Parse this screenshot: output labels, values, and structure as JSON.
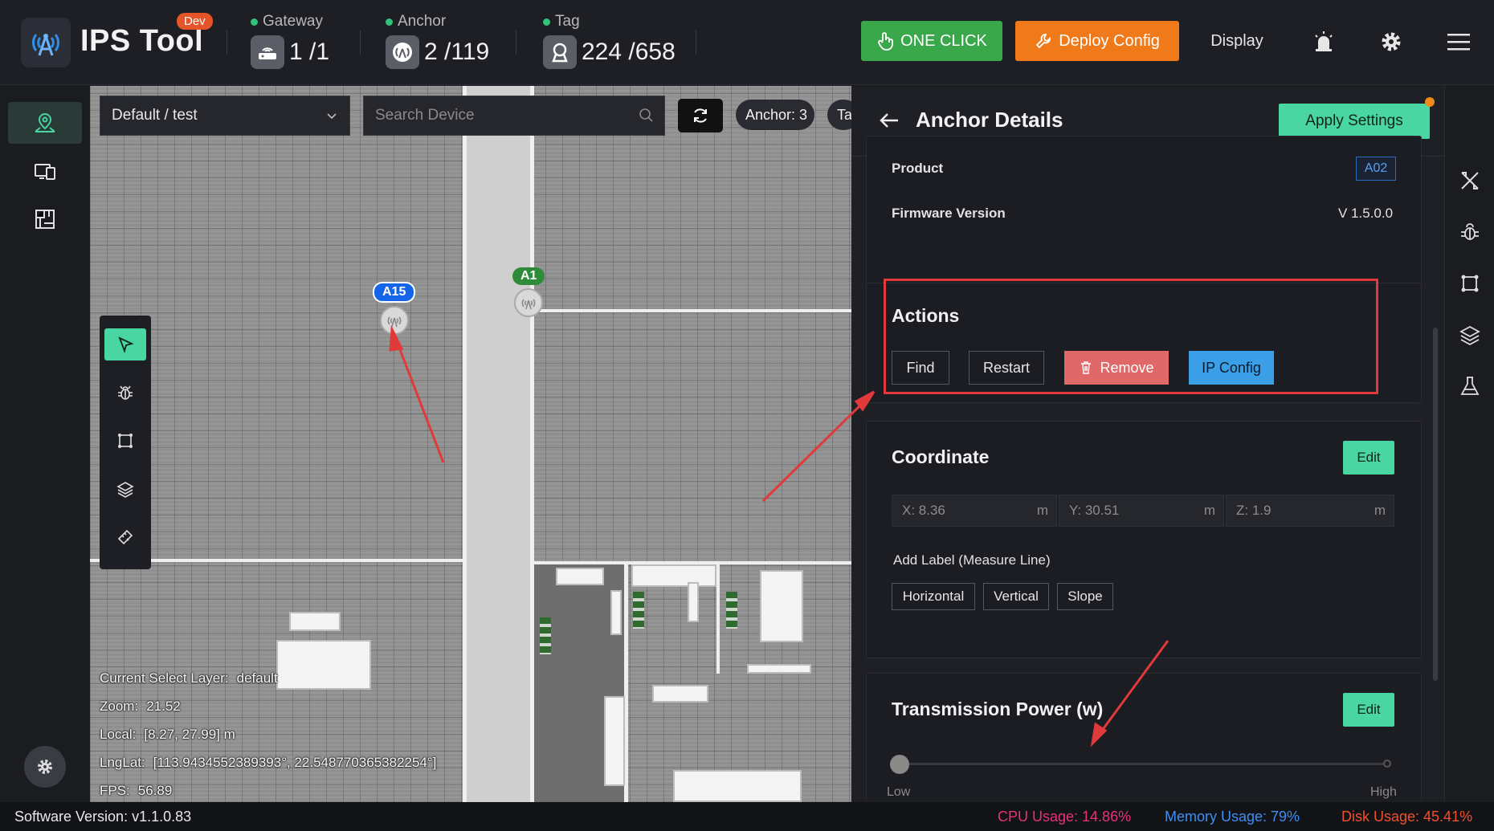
{
  "app": {
    "title": "IPS Tool",
    "badge": "Dev"
  },
  "stats": {
    "gateway": {
      "label": "Gateway",
      "value": "1 /1"
    },
    "anchor": {
      "label": "Anchor",
      "value": "2 /119"
    },
    "tag": {
      "label": "Tag",
      "value": "224 /658"
    }
  },
  "toolbar": {
    "one_click": "ONE CLICK",
    "deploy_config": "Deploy Config",
    "display": "Display"
  },
  "map": {
    "layer_select": "Default / test",
    "search_placeholder": "Search Device",
    "chip_anchor": "Anchor: 3",
    "chip_tag": "Ta",
    "anchors": [
      {
        "label": "A15",
        "color": "#1565e8"
      },
      {
        "label": "A1",
        "color": "#2e8b3a"
      }
    ],
    "info": {
      "layer_label": "Current Select Layer:",
      "layer_value": "default",
      "zoom_label": "Zoom:",
      "zoom_value": "21.52",
      "local_label": "Local:",
      "local_value": "[8.27, 27.99] m",
      "lnglat_label": "LngLat:",
      "lnglat_value": "[113.9434552389393°, 22.548770365382254°]",
      "fps_label": "FPS:",
      "fps_value": "56.89"
    }
  },
  "panel": {
    "title": "Anchor Details",
    "apply": "Apply Settings",
    "product_label": "Product",
    "product_value": "A02",
    "firmware_label": "Firmware Version",
    "firmware_value": "V 1.5.0.0",
    "actions": {
      "title": "Actions",
      "find": "Find",
      "restart": "Restart",
      "remove": "Remove",
      "ip_config": "IP Config"
    },
    "coordinate": {
      "title": "Coordinate",
      "edit": "Edit",
      "x": "X: 8.36",
      "y": "Y: 30.51",
      "z": "Z: 1.9",
      "unit": "m",
      "add_label_title": "Add Label (Measure Line)",
      "horizontal": "Horizontal",
      "vertical": "Vertical",
      "slope": "Slope"
    },
    "power": {
      "title": "Transmission Power (w)",
      "edit": "Edit",
      "low": "Low",
      "high": "High",
      "level": 0
    }
  },
  "status": {
    "software_version": "Software Version:  v1.1.0.83",
    "cpu": "CPU Usage:  14.86%",
    "memory": "Memory Usage:  79%",
    "disk": "Disk Usage:  45.41%",
    "colors": {
      "cpu": "#e8317a",
      "memory": "#3d8ff2",
      "disk": "#f0502a"
    }
  },
  "colors": {
    "accent": "#49d6a3",
    "annotation": "#e03a3a"
  }
}
